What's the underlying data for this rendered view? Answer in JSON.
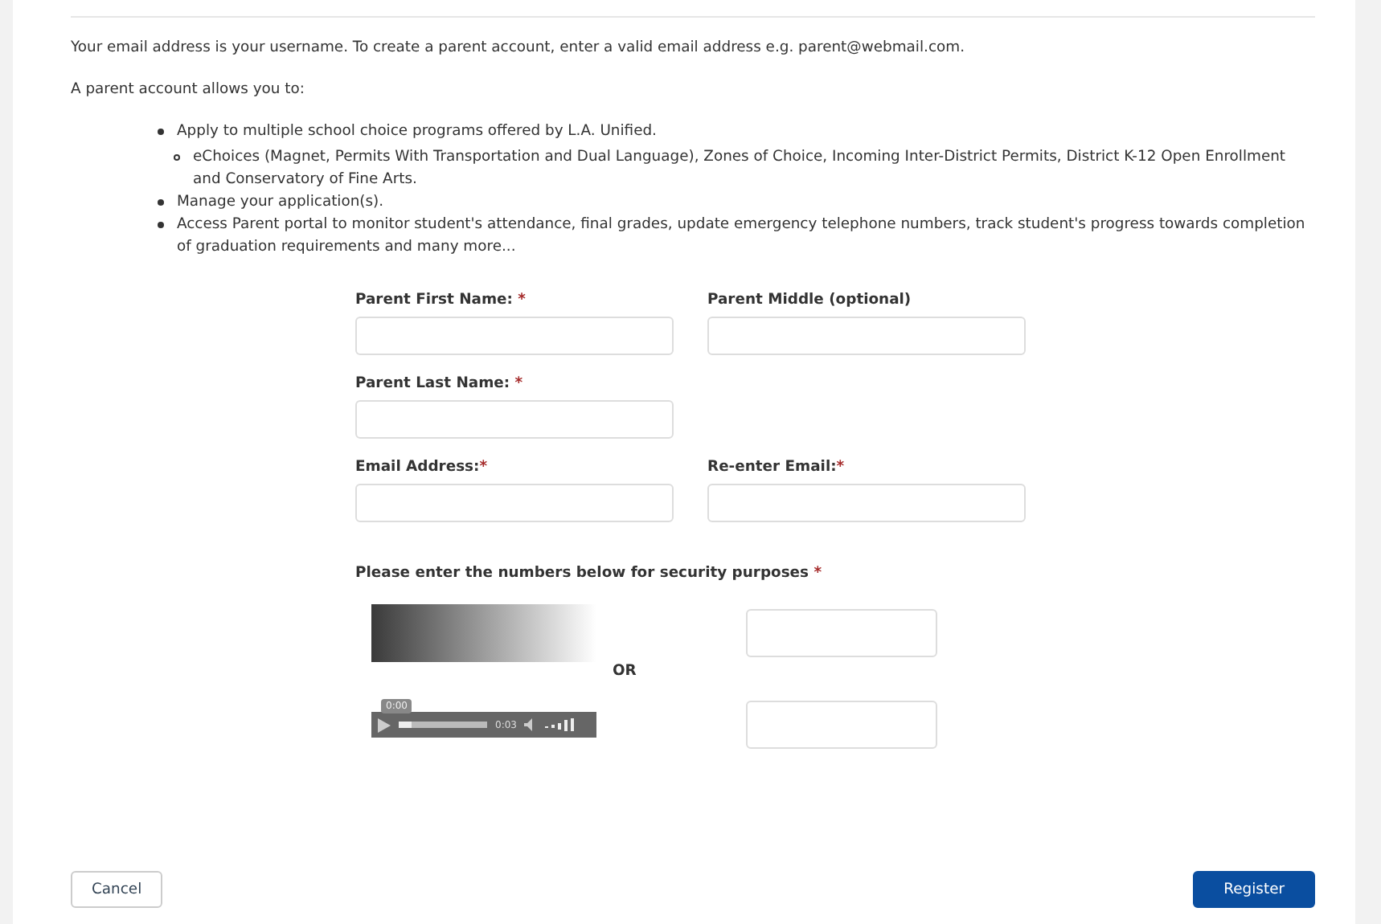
{
  "intro": "Your email address is your username. To create a parent account, enter a valid email address e.g. parent@webmail.com.",
  "allows_heading": "A parent account allows you to:",
  "benefits": [
    {
      "text": "Apply to multiple school choice programs offered by L.A. Unified.",
      "children": [
        {
          "text": "eChoices (Magnet, Permits With Transportation and Dual Language), Zones of Choice, Incoming Inter-District Permits, District K-12 Open Enrollment and Conservatory of Fine Arts."
        }
      ]
    },
    {
      "text": "Manage your application(s)."
    },
    {
      "text": "Access Parent portal to monitor student's attendance, final grades, update emergency telephone numbers, track student's progress towards completion of graduation requirements and many more..."
    }
  ],
  "form_rows": [
    [
      {
        "label": "Parent First Name:",
        "required_mark": " *"
      },
      {
        "label": "Parent Middle (optional)"
      }
    ],
    [
      {
        "label": "Parent Last Name:",
        "required_mark": " *"
      }
    ],
    [
      {
        "label": "Email Address:",
        "required_mark": "*"
      },
      {
        "label": "Re-enter Email:",
        "required_mark": "*"
      }
    ]
  ],
  "security": {
    "label": "Please enter the numbers below for security purposes",
    "required_mark": " *",
    "or": "OR",
    "audio": {
      "tooltip": "0:00",
      "duration": "0:03",
      "level": 0.15
    }
  },
  "buttons": {
    "cancel": "Cancel",
    "register": "Register"
  }
}
